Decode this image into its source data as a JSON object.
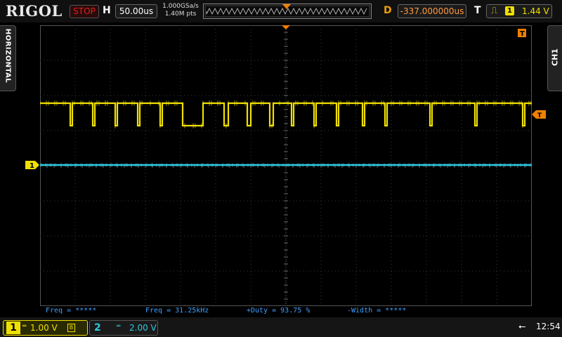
{
  "brand": "RIGOL",
  "run_state": "STOP",
  "horizontal": {
    "label": "H",
    "timebase": "50.00us",
    "sample_rate": "1.000GSa/s",
    "memory_depth": "1.40M pts"
  },
  "delay": {
    "label": "D",
    "value": "-337.000000us"
  },
  "trigger": {
    "label": "T",
    "source": "1",
    "level": "1.44 V",
    "edge_icon": "rising-edge-icon"
  },
  "side_tabs": {
    "left": "HORIZONTAL",
    "right": "CH1"
  },
  "channel_markers": {
    "ch1_ground_marker": "1",
    "trigger_level_marker": "T",
    "trigger_pos_marker": "T"
  },
  "measurements": [
    {
      "text": "Freq = *****"
    },
    {
      "text": "Freq = 31.25kHz"
    },
    {
      "text": "+Duty = 93.75 %"
    },
    {
      "text": "-Width = *****"
    }
  ],
  "channels": [
    {
      "number": "1",
      "scale": "1.00 V",
      "color": "#f0e000",
      "active": true
    },
    {
      "number": "2",
      "scale": "2.00 V",
      "color": "#30c8e0",
      "active": false
    }
  ],
  "status": {
    "clock": "12:54",
    "usb_icon": "usb-icon"
  },
  "colors": {
    "ch1": "#f0e000",
    "ch2": "#30c8e0",
    "trigger": "#f08000",
    "measure": "#40a0ff",
    "stop": "#e0201a"
  }
}
